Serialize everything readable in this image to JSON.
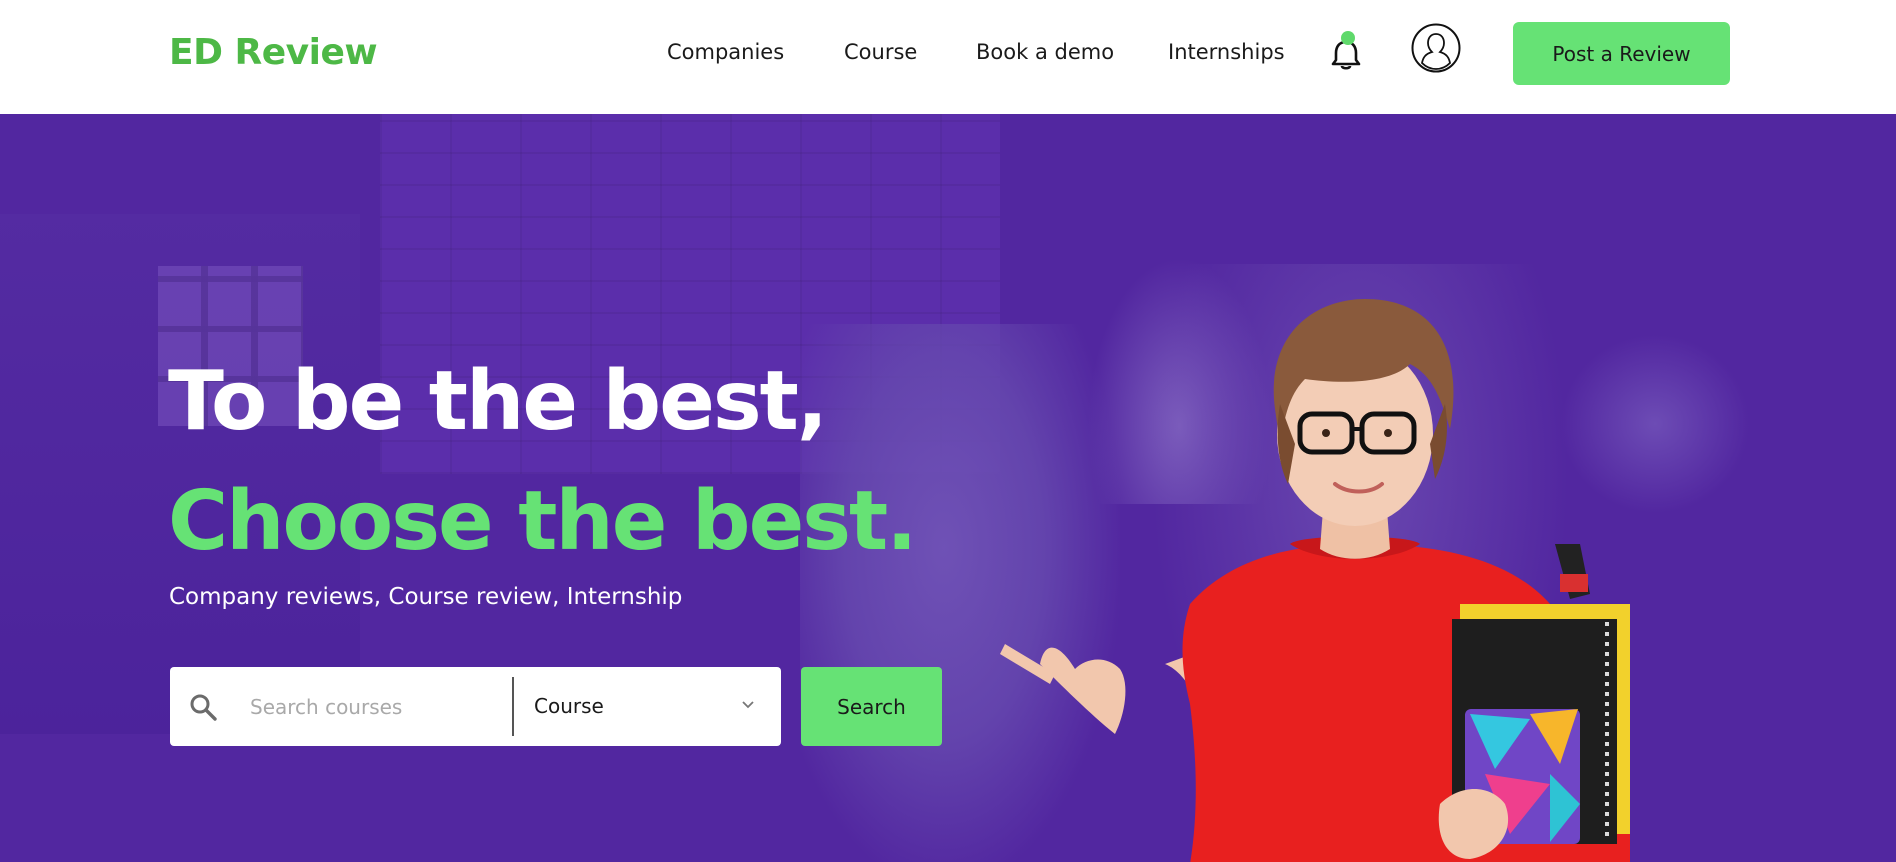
{
  "header": {
    "logo": "ED Review",
    "nav": [
      {
        "label": "Companies"
      },
      {
        "label": "Course"
      },
      {
        "label": "Book a demo"
      },
      {
        "label": "Internships"
      }
    ],
    "notification_icon": "bell-icon",
    "profile_icon": "user-icon",
    "cta_label": "Post a Review"
  },
  "hero": {
    "title_line1": "To be the best,",
    "title_line2": "Choose the best.",
    "subtitle": "Company reviews, Course review, Internship",
    "search": {
      "placeholder": "Search courses",
      "value": "",
      "category_selected": "Course",
      "button_label": "Search"
    }
  },
  "colors": {
    "brand_green": "#4db846",
    "accent_green": "#66e275",
    "hero_purple": "#5227a0",
    "text_dark": "#1a1a1a"
  }
}
